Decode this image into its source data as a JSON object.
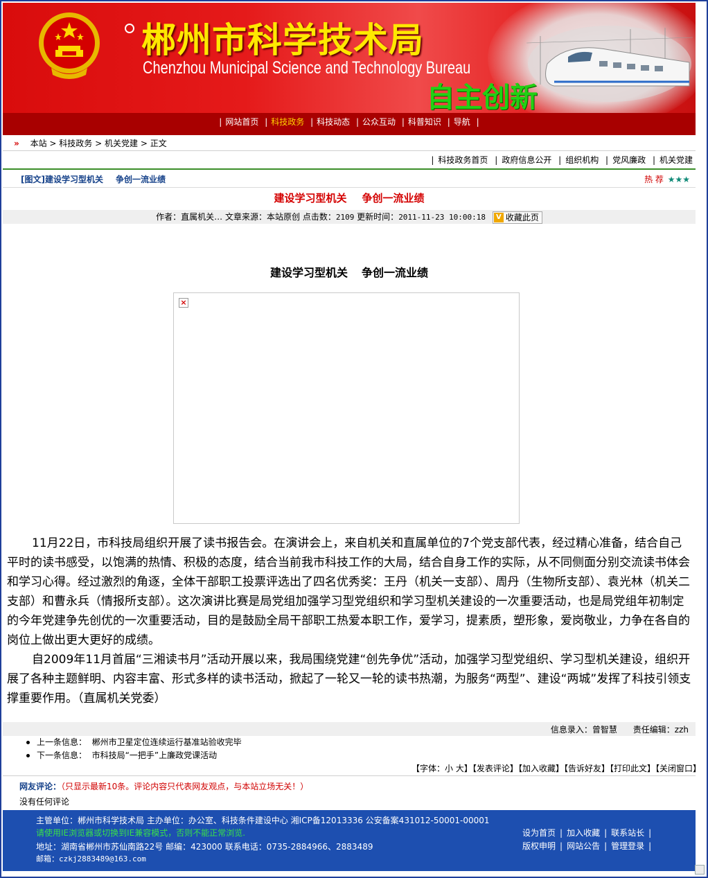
{
  "header": {
    "title": "郴州市科学技术局",
    "subtitle": "Chenzhou Municipal Science and Technology Bureau",
    "slogan": "自主创新"
  },
  "nav": {
    "items": [
      "网站首页",
      "科技政务",
      "科技动态",
      "公众互动",
      "科普知识",
      "导航"
    ],
    "active_index": 1,
    "active_color": "#ffd200"
  },
  "breadcrumb": {
    "arrow": "»",
    "items": [
      "本站",
      "科技政务",
      "机关党建",
      "正文"
    ]
  },
  "subnav": {
    "items": [
      "科技政务首页",
      "政府信息公开",
      "组织机构",
      "党风廉政",
      "机关党建"
    ]
  },
  "list_header": {
    "tag": "[图文]",
    "title_a": "建设学习型机关",
    "title_b": "争创一流业绩",
    "hot_label": "热 荐",
    "stars": "★★★"
  },
  "article": {
    "title_a": "建设学习型机关",
    "title_b": "争创一流业绩",
    "meta": {
      "author_label": "作者：",
      "author": "直属机关…",
      "source_label": "文章来源：",
      "source": "本站原创",
      "clicks_label": "点击数：",
      "clicks": "2109",
      "updated_label": "更新时间：",
      "updated": "2011-11-23 10:00:18",
      "fav_label": "收藏此页"
    },
    "heading_a": "建设学习型机关",
    "heading_b": "争创一流业绩",
    "paragraphs": [
      "11月22日，市科技局组织开展了读书报告会。在演讲会上，来自机关和直属单位的7个党支部代表，经过精心准备，结合自己平时的读书感受，以饱满的热情、积极的态度，结合当前我市科技工作的大局，结合自身工作的实际，从不同侧面分别交流读书体会和学习心得。经过激烈的角逐，全体干部职工投票评选出了四名优秀奖：王丹（机关一支部）、周丹（生物所支部）、袁光林（机关二支部）和曹永兵（情报所支部）。这次演讲比赛是局党组加强学习型党组织和学习型机关建设的一次重要活动，也是局党组年初制定的今年党建争先创优的一次重要活动，目的是鼓励全局干部职工热爱本职工作，爱学习，提素质，塑形象，爱岗敬业，力争在各自的岗位上做出更大更好的成绩。",
      "自2009年11月首届“三湘读书月”活动开展以来，我局围绕党建“创先争优”活动，加强学习型党组织、学习型机关建设，组织开展了各种主题鲜明、内容丰富、形式多样的读书活动，掀起了一轮又一轮的读书热潮，为服务“两型”、建设“两城”发挥了科技引领支撑重要作用。（直属机关党委）"
    ]
  },
  "info": {
    "entry_label": "信息录入：",
    "entry": "曾智慧",
    "editor_label": "责任编辑：",
    "editor": "zzh"
  },
  "prev_next": {
    "prev_label": "上一条信息：",
    "prev": "郴州市卫星定位连续运行基准站验收完毕",
    "next_label": "下一条信息：",
    "next": "市科技局“一把手”上廉政党课活动"
  },
  "tools": {
    "font_label": "【字体：",
    "small": "小",
    "large": "大",
    "font_close": "】",
    "items": [
      "【发表评论】",
      "【加入收藏】",
      "【告诉好友】",
      "【打印此文】",
      "【关闭窗口】"
    ]
  },
  "comments": {
    "label": "网友评论：",
    "note": "（只显示最新10条。评论内容只代表网友观点，与本站立场无关！）",
    "empty": "没有任何评论"
  },
  "footer": {
    "line1": "主管单位：郴州市科学技术局 主办单位：办公室、科技条件建设中心 湘ICP备12013336 公安备案431012-50001-00001",
    "line2": "请使用IE浏览器或切换到IE兼容模式，否则不能正常浏览.",
    "line3": "地址：湖南省郴州市苏仙南路22号 邮编：423000 联系电话：0735-2884966、2883489",
    "line4": "邮箱：czkj2883489@163.com",
    "links_row1": [
      "设为首页",
      "加入收藏",
      "联系站长"
    ],
    "links_row2": [
      "版权申明",
      "网站公告",
      "管理登录"
    ]
  }
}
